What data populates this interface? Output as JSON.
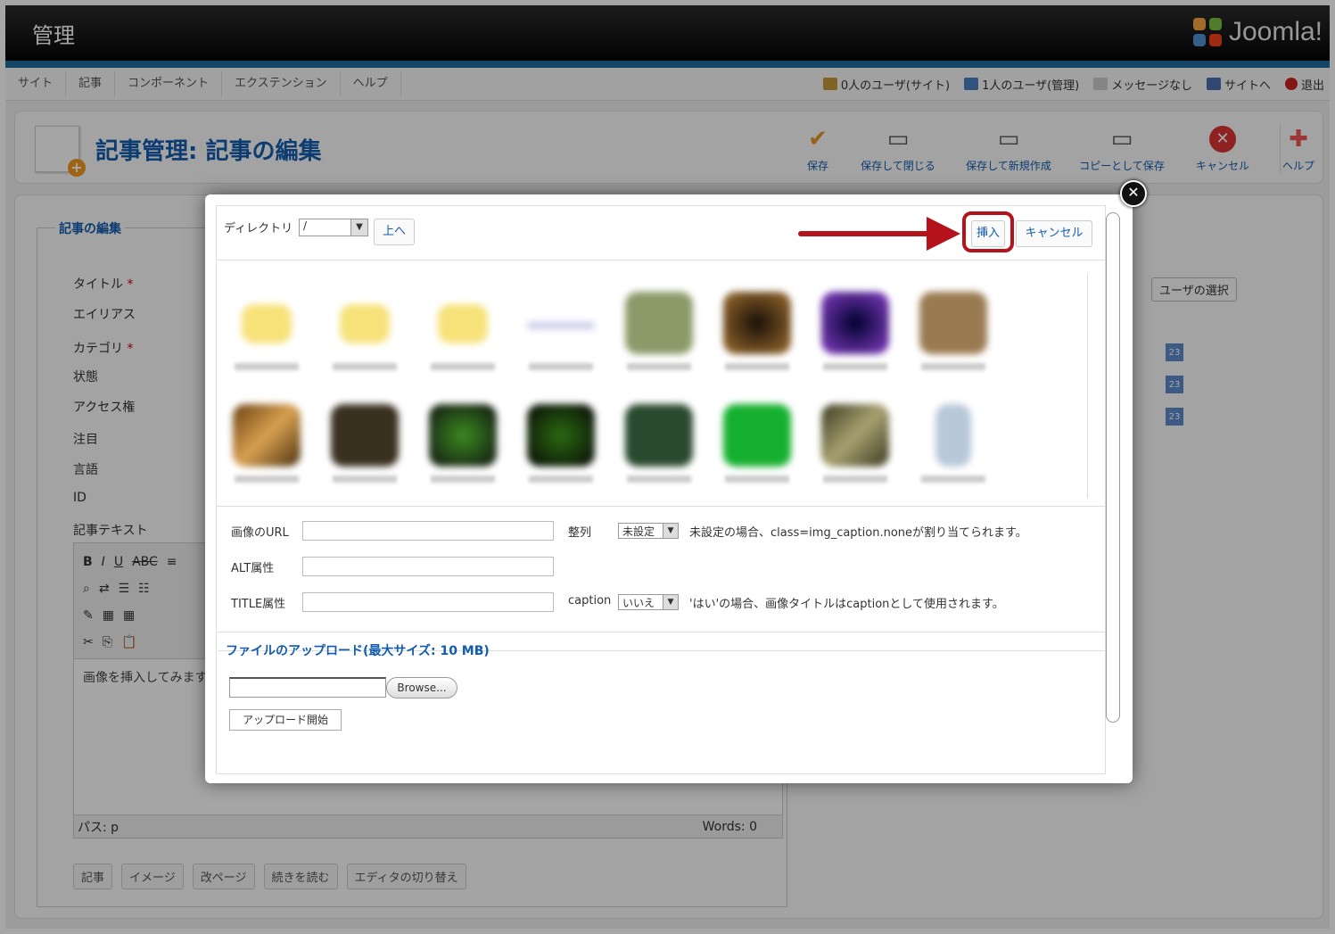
{
  "header": {
    "admin_label": "管理",
    "logo_text": "Joomla!"
  },
  "menu": [
    "サイト",
    "記事",
    "コンポーネント",
    "エクステンション",
    "ヘルプ"
  ],
  "status": [
    {
      "icon": "users-icon",
      "label": "0人のユーザ(サイト)"
    },
    {
      "icon": "admin-users-icon",
      "label": "1人のユーザ(管理)"
    },
    {
      "icon": "message-icon",
      "label": "メッセージなし"
    },
    {
      "icon": "site-icon",
      "label": "サイトへ"
    },
    {
      "icon": "logout-icon",
      "label": "退出"
    }
  ],
  "toolbar": {
    "title": "記事管理: 記事の編集",
    "buttons": [
      "保存",
      "保存して閉じる",
      "保存して新規作成",
      "コピーとして保存",
      "キャンセル",
      "ヘルプ"
    ]
  },
  "form": {
    "legend": "記事の編集",
    "labels": [
      "タイトル",
      "エイリアス",
      "カテゴリ",
      "状態",
      "アクセス権",
      "注目",
      "言語",
      "ID",
      "記事テキスト"
    ],
    "required_mark": "*",
    "editor_text": "画像を挿入してみます",
    "path_label": "パス: p",
    "words_label": "Words: 0",
    "editor_buttons": [
      "記事",
      "イメージ",
      "改ページ",
      "続きを読む",
      "エディタの切り替え"
    ],
    "user_select": "ユーザの選択",
    "calendar_label": "23"
  },
  "modal": {
    "dir_label": "ディレクトリ",
    "dir_value": "/",
    "up_label": "上へ",
    "insert_label": "挿入",
    "cancel_label": "キャンセル",
    "url_label": "画像のURL",
    "alt_label": "ALT属性",
    "title_label": "TITLE属性",
    "align_label": "整列",
    "align_value": "未設定",
    "align_note": "未設定の場合、class=img_caption.noneが割り当てられます。",
    "caption_label": "caption",
    "caption_value": "いいえ",
    "caption_note": "'はい'の場合、画像タイトルはcaptionとして使用されます。",
    "upload_legend": "ファイルのアップロード(最大サイズ: 10 MB)",
    "browse_label": "Browse...",
    "upload_start": "アップロード開始"
  },
  "colors": {
    "brand_blue": "#135cae",
    "highlight_red": "#b5131b",
    "header_stripe": "#1f6a9c"
  }
}
